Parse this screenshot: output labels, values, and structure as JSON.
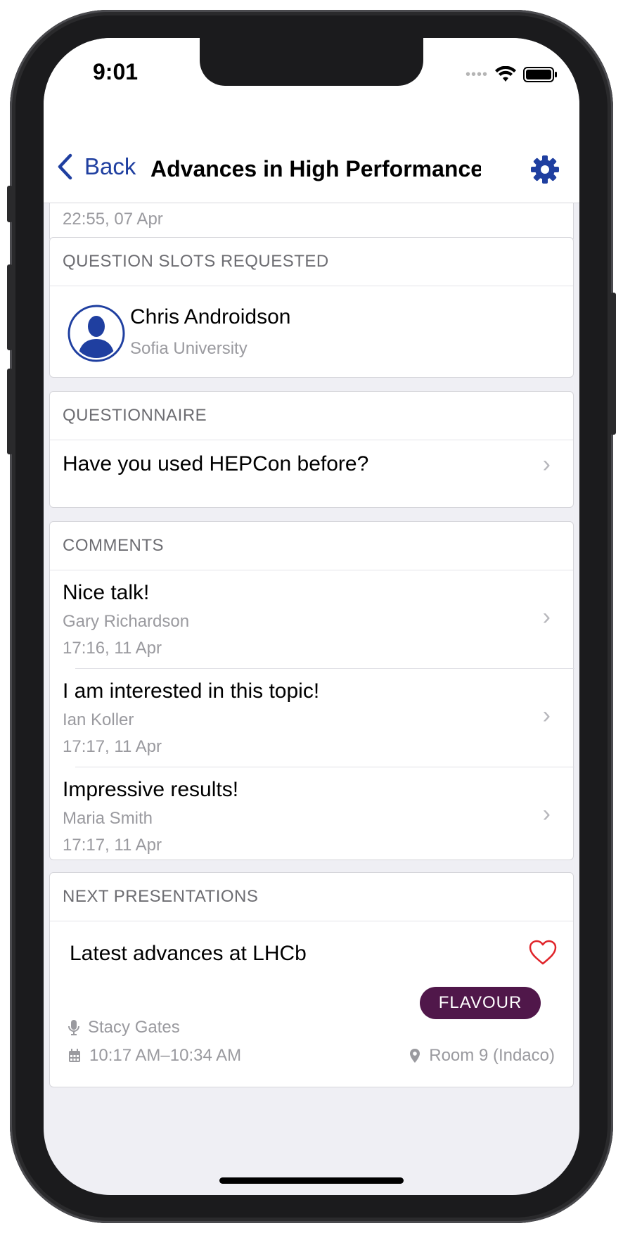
{
  "status": {
    "time": "9:01"
  },
  "nav": {
    "back_label": "Back",
    "title": "Advances in High Performance..."
  },
  "top_card": {
    "timestamp": "22:55, 07 Apr"
  },
  "question_slots": {
    "header": "QUESTION SLOTS REQUESTED",
    "person": {
      "name": "Chris Androidson",
      "affiliation": "Sofia University"
    }
  },
  "questionnaire": {
    "header": "QUESTIONNAIRE",
    "question": "Have you used HEPCon before?"
  },
  "comments": {
    "header": "COMMENTS",
    "items": [
      {
        "text": "Nice talk!",
        "author": "Gary Richardson",
        "time": "17:16, 11 Apr"
      },
      {
        "text": "I am interested in this topic!",
        "author": "Ian Koller",
        "time": "17:17, 11 Apr"
      },
      {
        "text": "Impressive results!",
        "author": "Maria Smith",
        "time": "17:17, 11 Apr"
      }
    ]
  },
  "next_presentations": {
    "header": "NEXT PRESENTATIONS",
    "items": [
      {
        "title": "Latest advances at LHCb",
        "tag": "FLAVOUR",
        "speaker": "Stacy Gates",
        "time": "10:17 AM–10:34 AM",
        "room": "Room 9 (Indaco)"
      }
    ]
  },
  "colors": {
    "accent": "#1f3fa0",
    "tag_bg": "#50174a",
    "heart": "#e0242a"
  },
  "icons": [
    "wifi-icon",
    "battery-icon",
    "chevron-left-icon",
    "gear-icon",
    "avatar-icon",
    "chevron-right-icon",
    "heart-icon",
    "microphone-icon",
    "calendar-icon",
    "location-pin-icon"
  ]
}
